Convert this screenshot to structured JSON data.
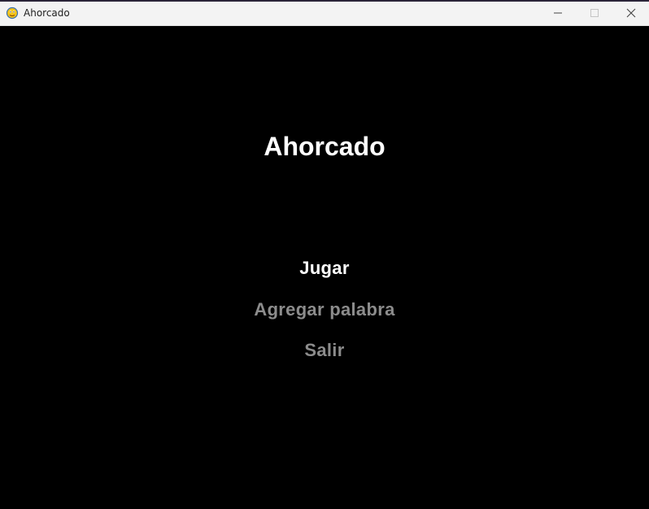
{
  "window": {
    "title": "Ahorcado",
    "icon": "pygame-snake-icon",
    "controls": {
      "minimize": "minimize-icon",
      "maximize": "maximize-icon",
      "close": "close-icon"
    }
  },
  "game": {
    "title": "Ahorcado",
    "menu": {
      "items": [
        {
          "label": "Jugar",
          "selected": true
        },
        {
          "label": "Agregar palabra",
          "selected": false
        },
        {
          "label": "Salir",
          "selected": false
        }
      ]
    }
  },
  "colors": {
    "background": "#000000",
    "title_text": "#ffffff",
    "menu_selected": "#ffffff",
    "menu_unselected": "#8c8c8c",
    "titlebar": "#f3f3f3"
  }
}
